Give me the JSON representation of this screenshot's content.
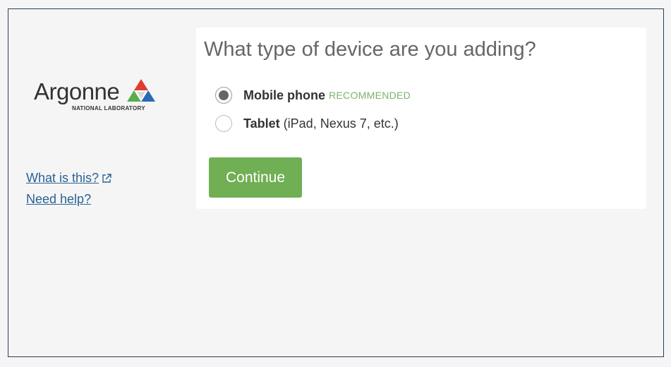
{
  "logo": {
    "name": "Argonne",
    "subtitle": "NATIONAL LABORATORY",
    "colors": [
      "#e23b2e",
      "#2a6ab4",
      "#5aad4e"
    ]
  },
  "side": {
    "what_is_this": "What is this?",
    "what_is_this_icon": "external-link-icon",
    "need_help": "Need help?"
  },
  "card": {
    "title": "What type of device are you adding?",
    "options": [
      {
        "label": "Mobile phone",
        "badge": "RECOMMENDED",
        "selected": true
      },
      {
        "label": "Tablet",
        "detail": "(iPad, Nexus 7, etc.)",
        "selected": false
      }
    ],
    "continue_label": "Continue"
  },
  "colors": {
    "accent_green": "#70af53",
    "link_blue": "#2b6296",
    "background": "#f5f5f5"
  }
}
